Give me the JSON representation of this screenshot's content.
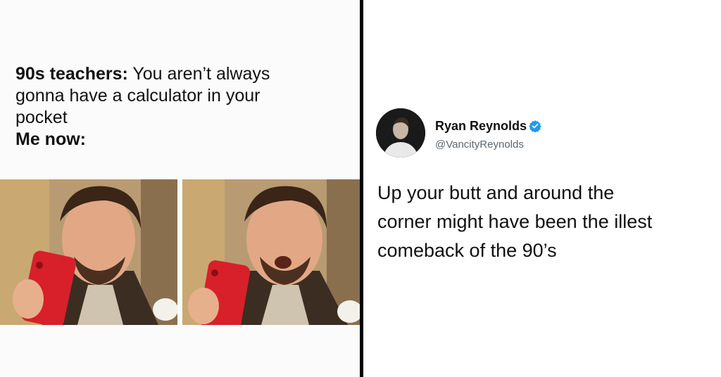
{
  "meme": {
    "subject_bold": "90s teachers:",
    "line1_rest": " You aren’t always",
    "line2": "gonna have a calculator in your",
    "line3": "pocket",
    "punchline": "Me now:"
  },
  "tweet": {
    "name": "Ryan Reynolds",
    "handle": "@VancityReynolds",
    "lines": [
      "Up your butt and around the",
      "corner might have been the illest",
      "comeback of the 90’s"
    ],
    "verified_color": "#1d9bf0"
  },
  "colors": {
    "phone": "#d7202a",
    "divider": "#000000"
  }
}
